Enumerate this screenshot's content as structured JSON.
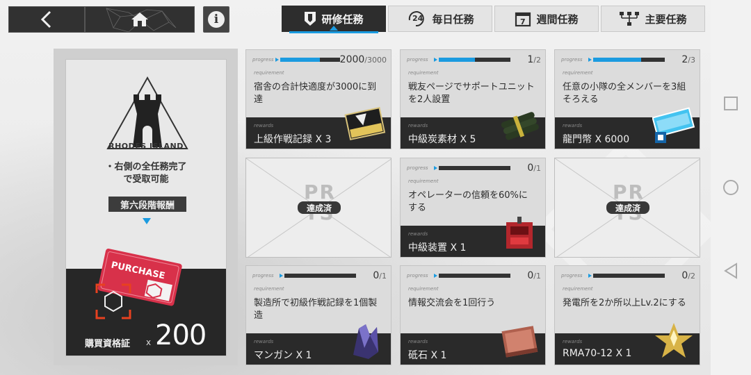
{
  "header": {
    "back_icon": "chevron-left-icon",
    "home_icon": "home-icon",
    "info_label": "i",
    "tabs": [
      {
        "label": "研修任務",
        "icon": "badge-icon",
        "active": true
      },
      {
        "label": "毎日任務",
        "icon": "24h-icon",
        "active": false
      },
      {
        "label": "週間任務",
        "icon": "calendar-7-icon",
        "active": false
      },
      {
        "label": "主要任務",
        "icon": "tree-icon",
        "active": false
      }
    ]
  },
  "left_panel": {
    "logo_text": "RHODES ISLAND",
    "condition_line1": "・右側の全任務完了",
    "condition_line2": "で受取可能",
    "stage_label": "第六段階報酬",
    "voucher_text": "PURCHASE",
    "reward_name": "購買資格証",
    "reward_x": "x",
    "reward_count": "200"
  },
  "labels": {
    "progress": "progress",
    "requirement": "requirement",
    "rewards": "rewards",
    "done": "達成済",
    "done_bg": "PR TS"
  },
  "missions": [
    {
      "progress_current": "2000",
      "progress_total": "/3000",
      "fraction": 0.667,
      "requirement": "宿舎の合計快適度が3000に到達",
      "reward": "上級作戦記録 X 3",
      "icon": "exp-card-icon",
      "done": false
    },
    {
      "progress_current": "1",
      "progress_total": "/2",
      "fraction": 0.5,
      "requirement": "戦友ページでサポートユニットを2人設置",
      "reward": "中級炭素材 X 5",
      "icon": "carbon-bundle-icon",
      "done": false
    },
    {
      "progress_current": "2",
      "progress_total": "/3",
      "fraction": 0.667,
      "requirement": "任意の小隊の全メンバーを3組そろえる",
      "reward": "龍門幣 X 6000",
      "icon": "lmd-currency-icon",
      "done": false
    },
    {
      "done": true
    },
    {
      "progress_current": "0",
      "progress_total": "/1",
      "fraction": 0.0,
      "requirement": "オペレーターの信頼を60%にする",
      "reward": "中級装置 X 1",
      "icon": "device-icon",
      "done": false
    },
    {
      "done": true
    },
    {
      "progress_current": "0",
      "progress_total": "/1",
      "fraction": 0.0,
      "requirement": "製造所で初級作戦記録を1個製造",
      "reward": "マンガン X 1",
      "icon": "manganese-icon",
      "done": false
    },
    {
      "progress_current": "0",
      "progress_total": "/1",
      "fraction": 0.0,
      "requirement": "情報交流会を1回行う",
      "reward": "砥石 X 1",
      "icon": "grindstone-icon",
      "done": false
    },
    {
      "progress_current": "0",
      "progress_total": "/2",
      "fraction": 0.0,
      "requirement": "発電所を2か所以上Lv.2にする",
      "reward": "RMA70-12 X 1",
      "icon": "rma-crystal-icon",
      "done": false
    }
  ],
  "colors": {
    "accent": "#1b9be0",
    "dark": "#2a2a2a",
    "card_bg": "#dcdcdc"
  }
}
